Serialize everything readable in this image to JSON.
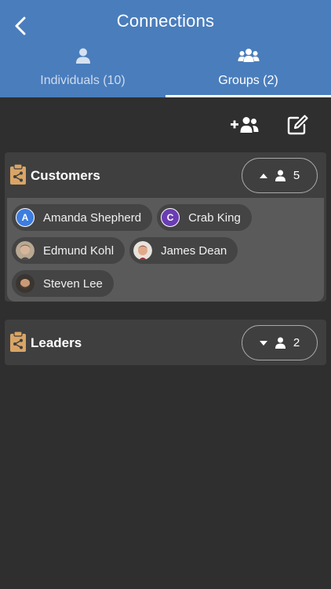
{
  "header": {
    "title": "Connections",
    "tabs": [
      {
        "label": "Individuals (10)",
        "icon": "person-icon",
        "active": false
      },
      {
        "label": "Groups (2)",
        "icon": "people-group-icon",
        "active": true
      }
    ]
  },
  "toolbar": {
    "add_icon": "add-group-icon",
    "edit_icon": "edit-icon"
  },
  "groups": [
    {
      "name": "Customers",
      "count": "5",
      "expanded": true,
      "members": [
        {
          "name": "Amanda Shepherd",
          "initial": "A",
          "color": "#3d7de0"
        },
        {
          "name": "Crab King",
          "initial": "C",
          "color": "#6a3db3"
        },
        {
          "name": "Edmund Kohl",
          "avatar": "photo"
        },
        {
          "name": "James Dean",
          "avatar": "photo"
        },
        {
          "name": "Steven Lee",
          "avatar": "photo"
        }
      ]
    },
    {
      "name": "Leaders",
      "count": "2",
      "expanded": false
    }
  ],
  "colors": {
    "header": "#4a7dbc",
    "background": "#2f2f2f",
    "clipboard": "#d9a566"
  }
}
